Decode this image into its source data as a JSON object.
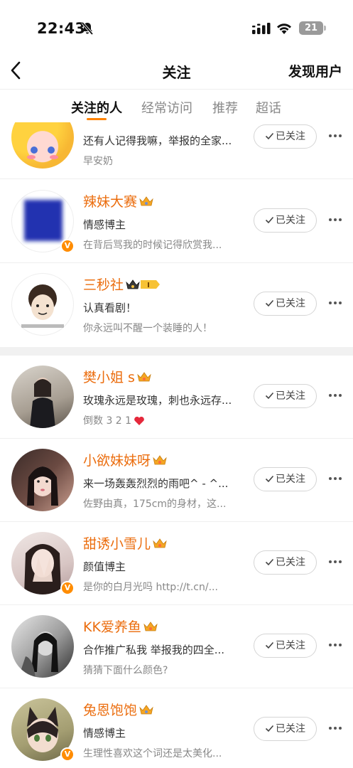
{
  "status_bar": {
    "time": "22:43",
    "mute_icon": "bell-slash-icon",
    "battery": "21"
  },
  "nav": {
    "title": "关注",
    "right_link": "发现用户",
    "back_icon": "chevron-left-icon"
  },
  "tabs": [
    {
      "label": "关注的人",
      "active": true
    },
    {
      "label": "经常访问",
      "active": false
    },
    {
      "label": "推荐",
      "active": false
    },
    {
      "label": "超话",
      "active": false
    }
  ],
  "follow_label": "已关注",
  "accent_color": "#ff8200",
  "name_color": "#eb6d0e",
  "users": [
    {
      "name": "",
      "desc": "还有人记得我嘛，举报的全家...",
      "sub": "早安奶",
      "verified": false
    },
    {
      "name": "辣妹大赛",
      "desc": "情感博主",
      "sub": "在背后骂我的时候记得欣赏我...",
      "verified": true
    },
    {
      "name": "三秒社",
      "desc": "认真看剧！",
      "sub": "你永远叫不醒一个装睡的人！",
      "verified": false,
      "level": "I"
    },
    {
      "name": "樊小姐 s",
      "desc": "玫瑰永远是玫瑰，刺也永远存...",
      "sub": "倒数 3 2 1",
      "verified": false
    },
    {
      "name": "小欲妹妹呀",
      "desc": "来一场轰轰烈烈的雨吧^ - ^...",
      "sub": "佐野由真，175cm的身材，这...",
      "verified": false
    },
    {
      "name": "甜诱小雪儿",
      "desc": "颜值博主",
      "sub": "是你的白月光吗 http://t.cn/...",
      "verified": true
    },
    {
      "name": "KK爱养鱼",
      "desc": "合作推广私我 举报我的四全...",
      "sub": "猜猜下面什么颜色?",
      "verified": false
    },
    {
      "name": "兔恩饱饱",
      "desc": "情感博主",
      "sub": "生理性喜欢这个词还是太美化...",
      "verified": true
    }
  ]
}
